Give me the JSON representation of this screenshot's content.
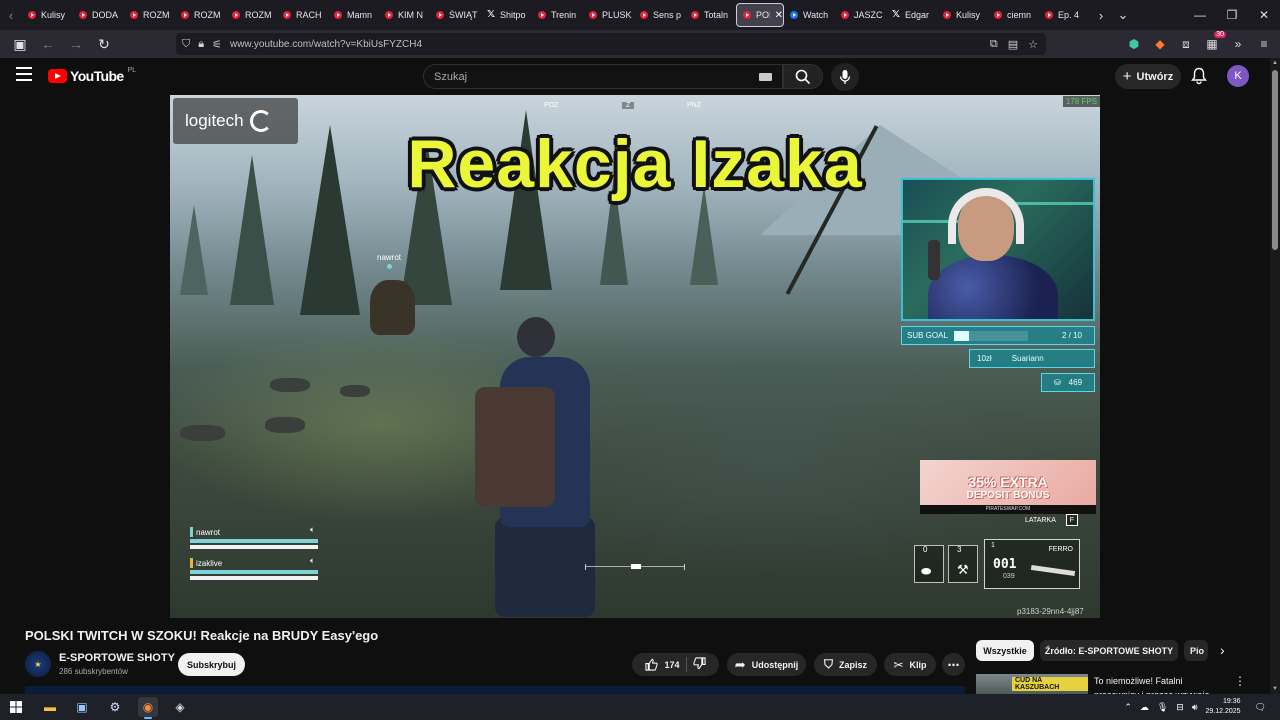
{
  "browser": {
    "tabs": [
      {
        "title": "Kulisy",
        "icon": "youtube-icon"
      },
      {
        "title": "DODA",
        "icon": "youtube-icon"
      },
      {
        "title": "ROZM",
        "icon": "youtube-icon"
      },
      {
        "title": "ROZM",
        "icon": "youtube-icon"
      },
      {
        "title": "ROZM",
        "icon": "youtube-icon"
      },
      {
        "title": "RACH",
        "icon": "youtube-icon"
      },
      {
        "title": "Mamn",
        "icon": "youtube-icon"
      },
      {
        "title": "KIM N",
        "icon": "youtube-icon"
      },
      {
        "title": "ŚWIĄT",
        "icon": "youtube-icon"
      },
      {
        "title": "Shitpo",
        "icon": "x-icon"
      },
      {
        "title": "Trenin",
        "icon": "youtube-icon"
      },
      {
        "title": "PLUSK",
        "icon": "youtube-icon"
      },
      {
        "title": "Sens p",
        "icon": "youtube-icon"
      },
      {
        "title": "Totaln",
        "icon": "youtube-icon"
      },
      {
        "title": "POL",
        "icon": "youtube-icon",
        "active": true
      },
      {
        "title": "Watch",
        "icon": "google-photos-icon"
      },
      {
        "title": "JASZC",
        "icon": "youtube-icon"
      },
      {
        "title": "Edgar",
        "icon": "x-icon"
      },
      {
        "title": "Kulisy",
        "icon": "youtube-icon"
      },
      {
        "title": "ciemn",
        "icon": "youtube-icon"
      },
      {
        "title": "Ep. 4",
        "icon": "youtube-icon"
      }
    ],
    "url": "www.youtube.com/watch?v=KbiUsFYZCH4",
    "extension_badge": "30"
  },
  "youtube": {
    "logo_text": "YouTube",
    "logo_region": "PL",
    "search_placeholder": "Szukaj",
    "create_label": "Utwórz",
    "avatar_letter": "K"
  },
  "video_overlay": {
    "sponsor": "logitech",
    "fps": "178 FPS",
    "compass": [
      "POZ",
      "Z",
      "PNZ"
    ],
    "caption": "Reakcja Izaka",
    "sub_goal_label": "SUB GOAL",
    "sub_goal_count": "2 / 10",
    "sub_goal_fraction": 0.2,
    "top_donor_amount": "10zł",
    "top_donor_name": "Suariann",
    "viewers": "469",
    "ad_line1": "35% EXTRA",
    "ad_line2": "DEPOSIT BONUS",
    "ad_url": "PIRATESWAP.COM",
    "latarka_label": "LATARKA",
    "latarka_key": "F",
    "slot0": "0",
    "slot3": "3",
    "weapon_slot": "1",
    "weapon_name": "FERRO",
    "ammo": "001",
    "ammo_reserve": "039",
    "session_id": "p3183-29nn4-4jj87",
    "player_tag": "nawrot",
    "squad": [
      {
        "name": "nawrot",
        "tag_color": "#7fd3d6"
      },
      {
        "name": "izaklive",
        "tag_color": "#e6b53c"
      }
    ]
  },
  "video": {
    "title": "POLSKI TWITCH W SZOKU! Reakcje na BRUDY Easy'ego",
    "channel_name": "E-SPORTOWE SHOTY",
    "channel_avatar_text": "E-SPORTOWE SHOTY",
    "subscribers": "286 subskrybentów",
    "subscribe_label": "Subskrybuj",
    "likes": "174",
    "share_label": "Udostępnij",
    "save_label": "Zapisz",
    "clip_label": "Klip"
  },
  "related": {
    "chips": [
      "Wszystkie",
      "Źródło: E-SPORTOWE SHOTY",
      "Pio"
    ],
    "first_title": "To niemożliwe! Fatalni pracownicy i prezes wzywają",
    "first_thumb_label": "CUD NA KASZUBACH"
  },
  "taskbar": {
    "time": "19:36",
    "date": "29.12.2025"
  },
  "colors": {
    "accent_red": "#ff0000",
    "caption_yellow": "#e9f738",
    "overlay_cyan": "#36c2d6",
    "avatar_purple": "#7e57c2"
  }
}
